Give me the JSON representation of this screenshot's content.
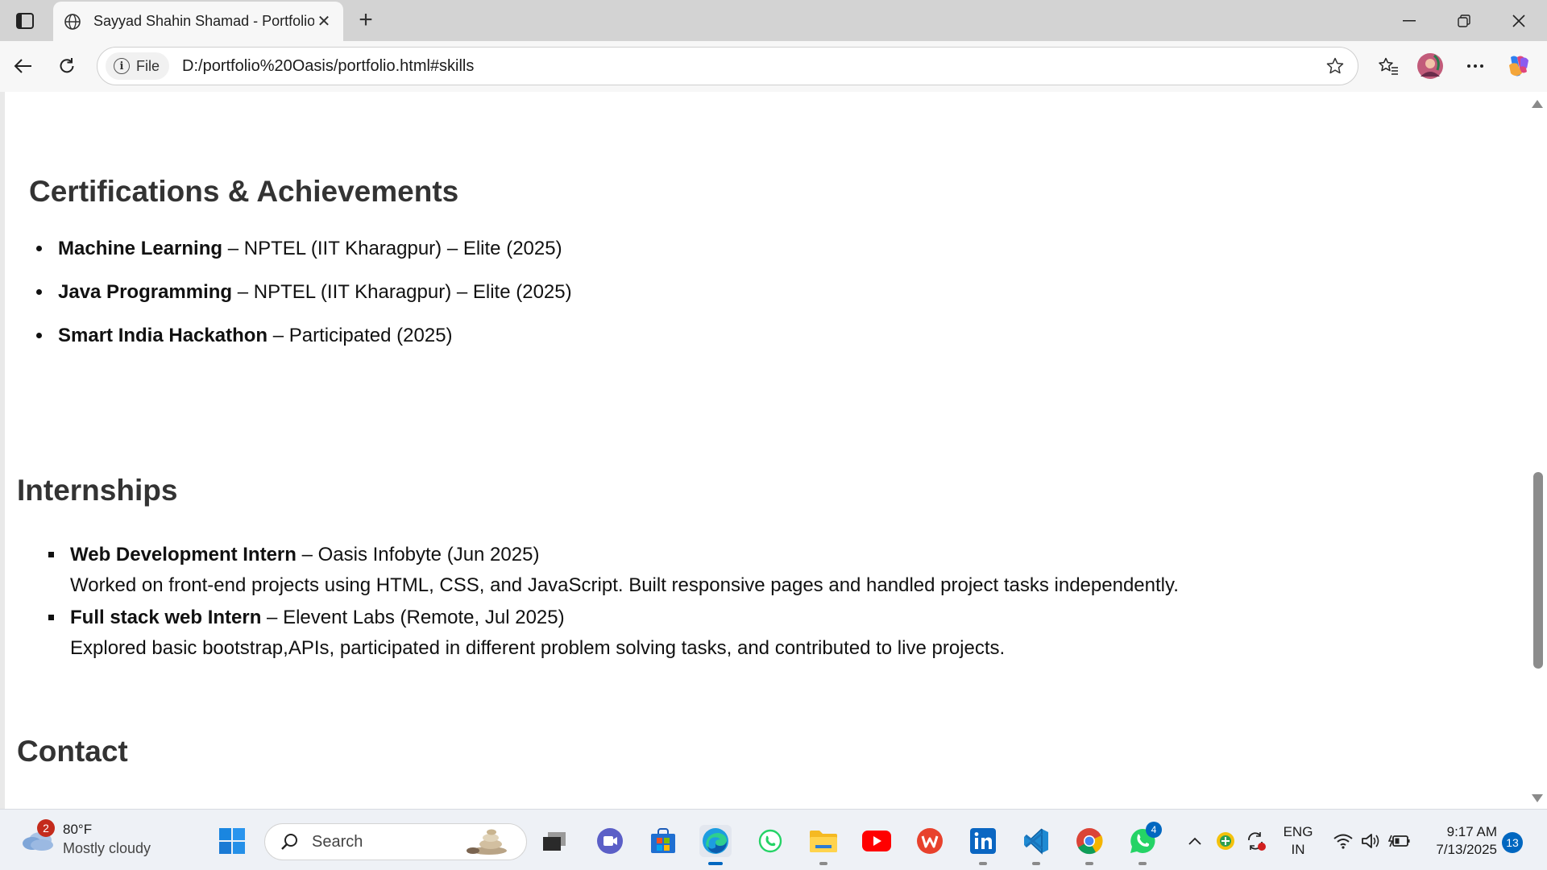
{
  "browser": {
    "tab_title": "Sayyad Shahin Shamad - Portfolio",
    "site_info_label": "File",
    "url": "D:/portfolio%20Oasis/portfolio.html#skills"
  },
  "page": {
    "certifications": {
      "heading": "Certifications & Achievements",
      "items": [
        {
          "title": "Machine Learning",
          "detail": " – NPTEL (IIT Kharagpur) – Elite (2025)"
        },
        {
          "title": "Java Programming",
          "detail": " – NPTEL (IIT Kharagpur) – Elite (2025)"
        },
        {
          "title": "Smart India Hackathon",
          "detail": " – Participated (2025)"
        }
      ]
    },
    "internships": {
      "heading": "Internships",
      "items": [
        {
          "title": "Web Development Intern",
          "detail": " – Oasis Infobyte (Jun 2025)",
          "description": "Worked on front-end projects using HTML, CSS, and JavaScript. Built responsive pages and handled project tasks independently."
        },
        {
          "title": "Full stack web Intern",
          "detail": " – Elevent Labs (Remote, Jul 2025)",
          "description": "Explored basic bootstrap,APIs, participated in different problem solving tasks, and contributed to live projects."
        }
      ]
    },
    "contact": {
      "heading": "Contact"
    }
  },
  "taskbar": {
    "weather": {
      "badge": "2",
      "temp": "80°F",
      "condition": "Mostly cloudy"
    },
    "search_placeholder": "Search",
    "whatsapp_badge": "4",
    "language": {
      "line1": "ENG",
      "line2": "IN"
    },
    "clock": {
      "time": "9:17 AM",
      "date": "7/13/2025"
    },
    "notification_count": "13"
  },
  "colors": {
    "accent": "#0067c0",
    "heading": "#333333",
    "tab_bar": "#d3d3d3"
  }
}
